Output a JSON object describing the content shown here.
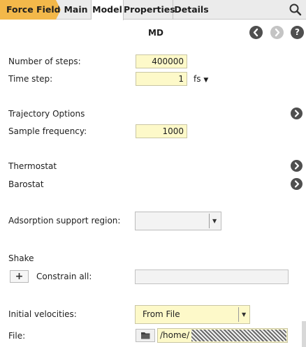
{
  "tabs": [
    {
      "label": "Force Field"
    },
    {
      "label": "Main"
    },
    {
      "label": "Model"
    },
    {
      "label": "Properties"
    },
    {
      "label": "Details"
    }
  ],
  "panel": {
    "title": "MD",
    "nav": {
      "back": "‹",
      "forward": "›",
      "help": "?"
    }
  },
  "settings": {
    "steps": {
      "label": "Number of steps:",
      "value": "400000"
    },
    "timestep": {
      "label": "Time step:",
      "value": "1",
      "unit": "fs"
    },
    "trajectory": {
      "label": "Trajectory Options"
    },
    "sample_freq": {
      "label": "Sample frequency:",
      "value": "1000"
    },
    "thermostat": {
      "label": "Thermostat"
    },
    "barostat": {
      "label": "Barostat"
    },
    "adsorption": {
      "label": "Adsorption support region:",
      "value": ""
    },
    "shake": {
      "label": "Shake",
      "add": "+",
      "constrain_label": "Constrain all:",
      "constrain_value": ""
    },
    "init_vel": {
      "label": "Initial velocities:",
      "value": "From File"
    },
    "file": {
      "label": "File:",
      "value": "/home/"
    }
  },
  "colors": {
    "active_tab": "#f3b84a",
    "input_bg": "#fdf9c9",
    "nav_button": "#4f4f4f"
  }
}
